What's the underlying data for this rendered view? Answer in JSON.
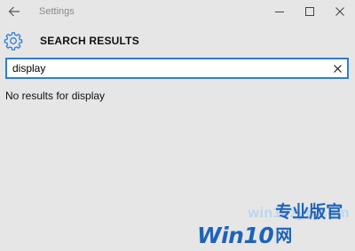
{
  "window": {
    "title": "Settings",
    "icons": {
      "back": "back-arrow-icon",
      "minimize": "minimize-icon",
      "maximize": "maximize-icon",
      "close": "close-icon"
    }
  },
  "header": {
    "title": "SEARCH RESULTS",
    "icon": "gear-icon"
  },
  "search": {
    "value": "display",
    "clear_icon": "clear-icon"
  },
  "results": {
    "message": "No results for display"
  },
  "watermark": {
    "site": "win10zyb.com",
    "brand": "Win10",
    "brand_cn": "专业版官网"
  },
  "colors": {
    "accent": "#2d7cd6",
    "background": "#e6e6e6",
    "watermark": "#1f63b8"
  }
}
